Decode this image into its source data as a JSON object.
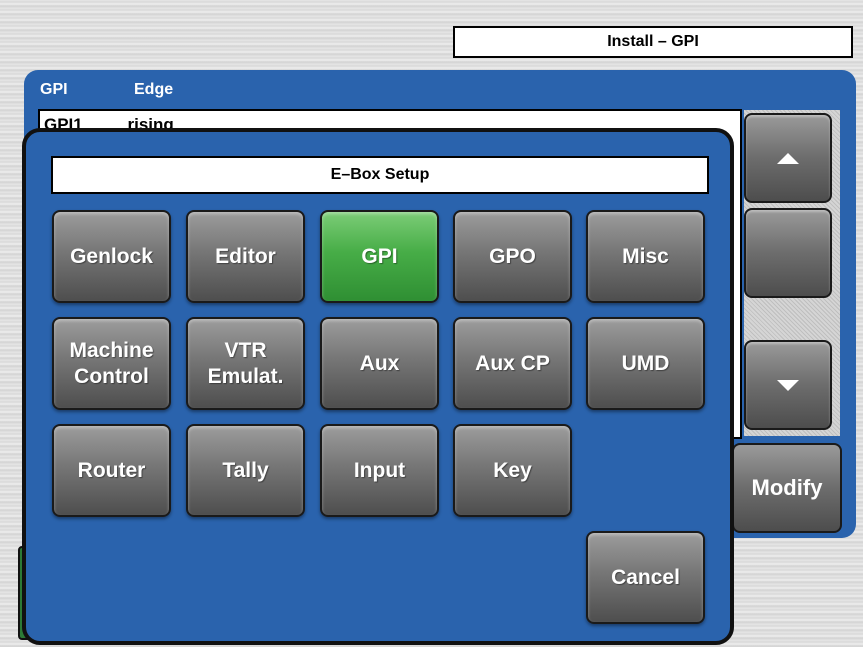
{
  "window": {
    "title": "Install – GPI"
  },
  "list": {
    "columns": [
      "GPI",
      "Edge"
    ],
    "rows": [
      {
        "gpi": "GPI1",
        "edge": "rising"
      }
    ]
  },
  "side_buttons": {
    "modify_label": "Modify"
  },
  "dialog": {
    "title": "E–Box Setup",
    "active_color": "#47ad47",
    "buttons": [
      {
        "label": "Genlock"
      },
      {
        "label": "Editor"
      },
      {
        "label": "GPI",
        "active": true
      },
      {
        "label": "GPO"
      },
      {
        "label": "Misc"
      },
      {
        "label": "Machine\nControl"
      },
      {
        "label": "VTR\nEmulat."
      },
      {
        "label": "Aux"
      },
      {
        "label": "Aux CP"
      },
      {
        "label": "UMD"
      },
      {
        "label": "Router"
      },
      {
        "label": "Tally"
      },
      {
        "label": "Input"
      },
      {
        "label": "Key"
      }
    ],
    "cancel_label": "Cancel"
  }
}
